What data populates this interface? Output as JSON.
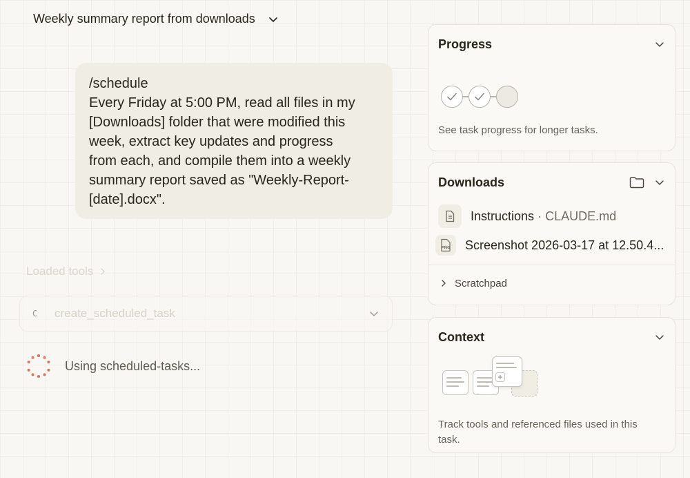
{
  "header": {
    "title": "Weekly summary report from downloads"
  },
  "message": {
    "lines": [
      "/schedule",
      "Every Friday at 5:00 PM, read all files in my",
      "[Downloads] folder that were modified this",
      "week, extract key updates and progress",
      "from each, and compile them into a weekly",
      "summary report saved as \"Weekly-Report-",
      "[date].docx\"."
    ]
  },
  "tools": {
    "loaded_label": "Loaded tools",
    "tool_prefix": "C",
    "tool_name": "create_scheduled_task"
  },
  "status": {
    "text": "Using scheduled-tasks..."
  },
  "progress": {
    "title": "Progress",
    "description": "See task progress for longer tasks.",
    "steps": [
      "done",
      "done",
      "pending"
    ]
  },
  "downloads": {
    "title": "Downloads",
    "files": [
      {
        "name": "Instructions",
        "separator": "·",
        "sub": "CLAUDE.md",
        "icon": "document-icon"
      },
      {
        "name": "Screenshot 2026-03-17 at 12.50.4...",
        "icon": "png-file-icon",
        "icon_label": "PNG"
      }
    ],
    "scratchpad": "Scratchpad"
  },
  "context": {
    "title": "Context",
    "description_lines": [
      "Track tools and referenced files used in this",
      "task."
    ]
  },
  "colors": {
    "accent": "#d97757",
    "bubble": "#efede4",
    "background": "#f9f7f3"
  }
}
